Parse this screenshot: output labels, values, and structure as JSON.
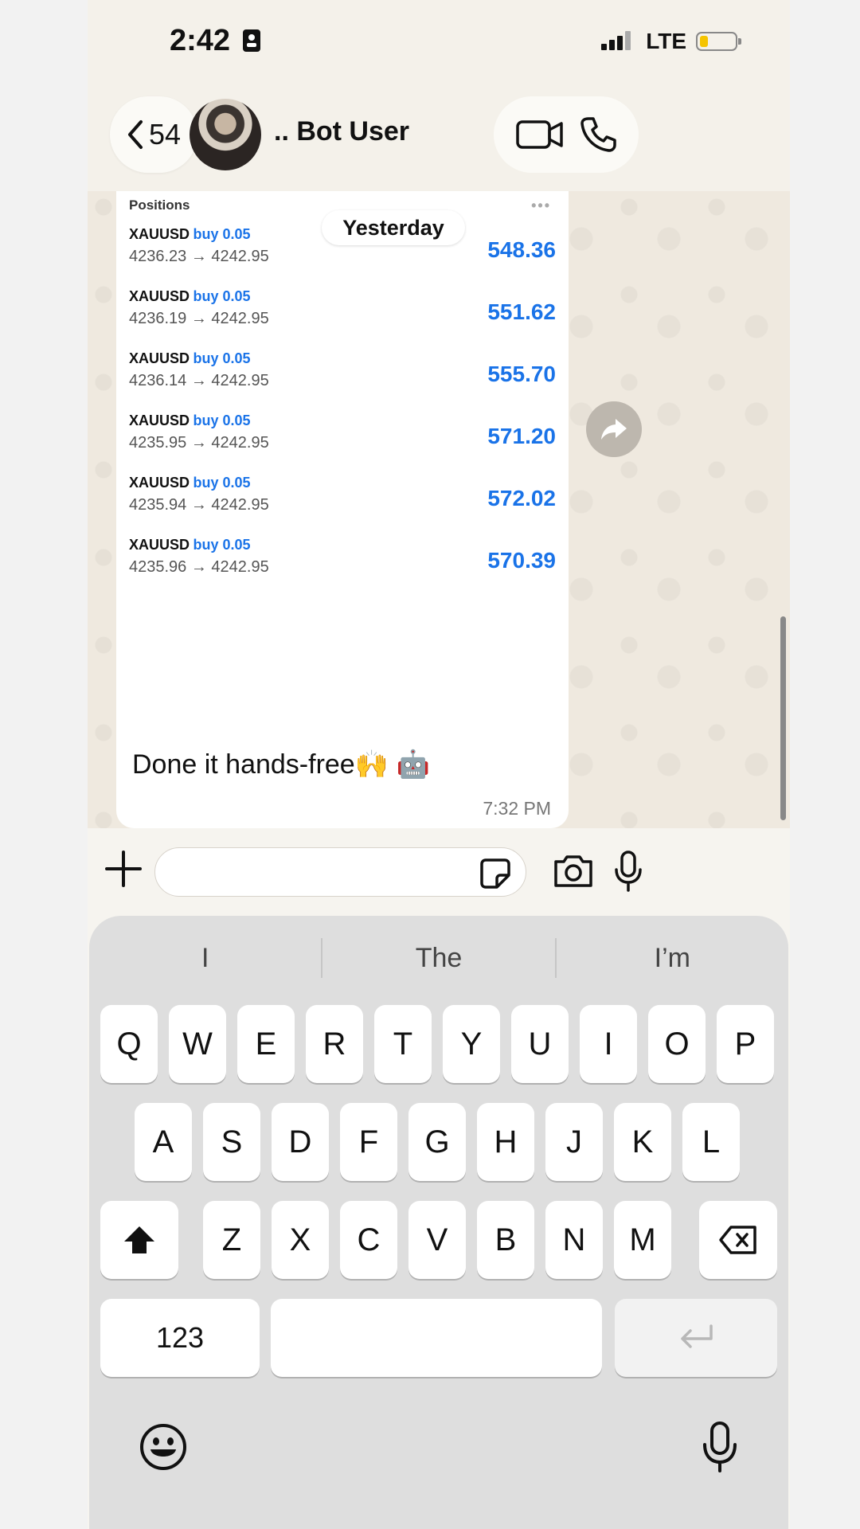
{
  "status_bar": {
    "time": "2:42",
    "network": "LTE"
  },
  "header": {
    "back_count": "54",
    "contact_name": ".. Bot User"
  },
  "chat": {
    "date_label": "Yesterday",
    "positions_title": "Positions",
    "positions": [
      {
        "symbol": "XAUUSD",
        "side": "buy 0.05",
        "prices": "4236.23 → 4242.95",
        "profit": "548.36"
      },
      {
        "symbol": "XAUUSD",
        "side": "buy 0.05",
        "prices": "4236.19 → 4242.95",
        "profit": "551.62"
      },
      {
        "symbol": "XAUUSD",
        "side": "buy 0.05",
        "prices": "4236.14 → 4242.95",
        "profit": "555.70"
      },
      {
        "symbol": "XAUUSD",
        "side": "buy 0.05",
        "prices": "4235.95 → 4242.95",
        "profit": "571.20"
      },
      {
        "symbol": "XAUUSD",
        "side": "buy 0.05",
        "prices": "4235.94 → 4242.95",
        "profit": "572.02"
      },
      {
        "symbol": "XAUUSD",
        "side": "buy 0.05",
        "prices": "4235.96 → 4242.95",
        "profit": "570.39"
      }
    ],
    "message_text": "Done it hands-free🙌 🤖",
    "message_time": "7:32 PM"
  },
  "composer": {
    "input_value": "",
    "placeholder": ""
  },
  "keyboard": {
    "suggestions": [
      "I",
      "The",
      "I’m"
    ],
    "row1": [
      "Q",
      "W",
      "E",
      "R",
      "T",
      "Y",
      "U",
      "I",
      "O",
      "P"
    ],
    "row2": [
      "A",
      "S",
      "D",
      "F",
      "G",
      "H",
      "J",
      "K",
      "L"
    ],
    "row3": [
      "Z",
      "X",
      "C",
      "V",
      "B",
      "N",
      "M"
    ],
    "numbers_key": "123"
  },
  "colors": {
    "profit_blue": "#1a73e8",
    "battery": "#f5c400"
  }
}
